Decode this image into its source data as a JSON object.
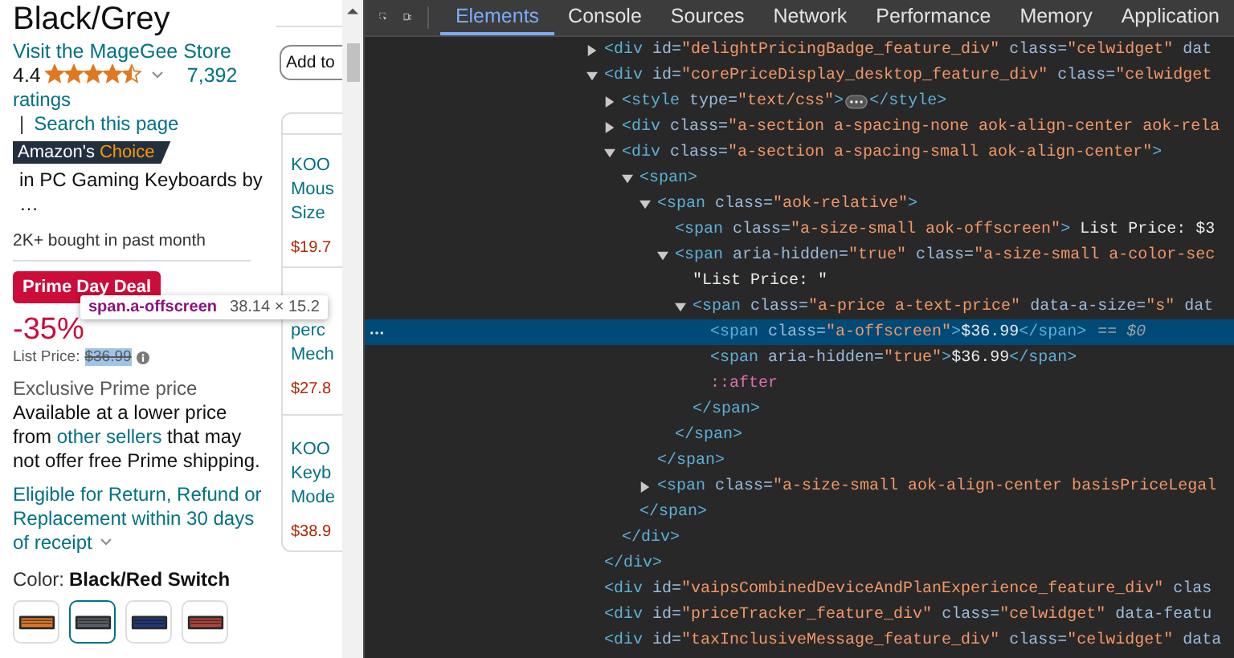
{
  "product": {
    "title": "Black/Grey",
    "store_link": "Visit the MageGee Store",
    "rating": {
      "value": "4.4",
      "stars": 4.5,
      "count_link": "7,392",
      "count_label": "ratings"
    },
    "separator": "|",
    "search_link": "Search this page",
    "choice_badge": {
      "prefix": "Amazon's",
      "highlight": "Choice"
    },
    "choice_category": "in PC Gaming Keyboards by …",
    "bought": "2K+ bought in past month",
    "deal_badge": "Prime Day Deal",
    "discount": "-35%",
    "list_price_label": "List Price:",
    "list_price": {
      "text": "$36.99",
      "inspected": true
    },
    "exclusive": "Exclusive Prime price",
    "availability": {
      "before": "Available at a lower price from",
      "link": "other sellers",
      "after": "that may not offer free Prime shipping."
    },
    "returns_link": "Eligible for Return, Refund or Replacement within 30 days of receipt",
    "color_label": "Color:",
    "color_value": "Black/Red Switch",
    "swatches": [
      {
        "selected": false,
        "color": "#e07a2a"
      },
      {
        "selected": true,
        "color": "#5a6068"
      },
      {
        "selected": false,
        "color": "#1f3a7a"
      },
      {
        "selected": false,
        "color": "#b0443c"
      }
    ]
  },
  "side_panel": {
    "add_button": "Add to",
    "cards": [
      {
        "lines": [
          "KOO",
          "Mous",
          "Size"
        ],
        "price": "$19.7"
      },
      {
        "lines": [
          "perc",
          "Mech"
        ],
        "price": "$27.8"
      },
      {
        "lines": [
          "KOO",
          "Keyb",
          "Mode"
        ],
        "price": "$38.9"
      }
    ]
  },
  "inspect_tooltip": {
    "selector": "span.a-offscreen",
    "size": "38.14 × 15.2"
  },
  "devtools": {
    "tabs": [
      {
        "label": "Elements",
        "selected": true
      },
      {
        "label": "Console",
        "selected": false
      },
      {
        "label": "Sources",
        "selected": false
      },
      {
        "label": "Network",
        "selected": false
      },
      {
        "label": "Performance",
        "selected": false
      },
      {
        "label": "Memory",
        "selected": false
      },
      {
        "label": "Application",
        "selected": false
      }
    ],
    "dom_tree": [
      {
        "selected": false,
        "expanded": false,
        "open": [
          {
            "kind": "tag",
            "text": "<div"
          },
          {
            "kind": "attr",
            "text": " id="
          },
          {
            "kind": "value",
            "text": "\"delightPricingBadge_feature_div\""
          },
          {
            "kind": "attr",
            "text": " class="
          },
          {
            "kind": "value",
            "text": "\"celwidget\""
          },
          {
            "kind": "attr",
            "text": " dat"
          }
        ]
      },
      {
        "selected": false,
        "expanded": true,
        "open": [
          {
            "kind": "tag",
            "text": "<div"
          },
          {
            "kind": "attr",
            "text": " id="
          },
          {
            "kind": "value",
            "text": "\"corePriceDisplay_desktop_feature_div\""
          },
          {
            "kind": "attr",
            "text": " class="
          },
          {
            "kind": "value",
            "text": "\"celwidget"
          }
        ],
        "close": [
          {
            "kind": "tag",
            "text": "</div>"
          }
        ],
        "children": [
          {
            "selected": false,
            "expanded": false,
            "open": [
              {
                "kind": "tag",
                "text": "<style"
              },
              {
                "kind": "attr",
                "text": " type="
              },
              {
                "kind": "value",
                "text": "\"text/css\""
              },
              {
                "kind": "tag",
                "text": ">"
              },
              {
                "kind": "ellipsis"
              },
              {
                "kind": "tag",
                "text": "</style>"
              }
            ]
          },
          {
            "selected": false,
            "expanded": false,
            "open": [
              {
                "kind": "tag",
                "text": "<div"
              },
              {
                "kind": "attr",
                "text": " class="
              },
              {
                "kind": "value",
                "text": "\"a-section a-spacing-none aok-align-center aok-rela"
              }
            ]
          },
          {
            "selected": false,
            "expanded": true,
            "open": [
              {
                "kind": "tag",
                "text": "<div"
              },
              {
                "kind": "attr",
                "text": " class="
              },
              {
                "kind": "value",
                "text": "\"a-section a-spacing-small aok-align-center\""
              },
              {
                "kind": "tag",
                "text": ">"
              }
            ],
            "close": [
              {
                "kind": "tag",
                "text": "</div>"
              }
            ],
            "children": [
              {
                "selected": false,
                "expanded": true,
                "open": [
                  {
                    "kind": "tag",
                    "text": "<span>"
                  }
                ],
                "close": [
                  {
                    "kind": "tag",
                    "text": "</span>"
                  }
                ],
                "children": [
                  {
                    "selected": false,
                    "expanded": true,
                    "open": [
                      {
                        "kind": "tag",
                        "text": "<span"
                      },
                      {
                        "kind": "attr",
                        "text": " class="
                      },
                      {
                        "kind": "value",
                        "text": "\"aok-relative\""
                      },
                      {
                        "kind": "tag",
                        "text": ">"
                      }
                    ],
                    "close": [
                      {
                        "kind": "tag",
                        "text": "</span>"
                      }
                    ],
                    "children": [
                      {
                        "selected": false,
                        "open": [
                          {
                            "kind": "tag",
                            "text": "<span"
                          },
                          {
                            "kind": "attr",
                            "text": " class="
                          },
                          {
                            "kind": "value",
                            "text": "\"a-size-small aok-offscreen\""
                          },
                          {
                            "kind": "tag",
                            "text": ">"
                          },
                          {
                            "kind": "text",
                            "text": " List Price: $3"
                          }
                        ]
                      },
                      {
                        "selected": false,
                        "expanded": true,
                        "open": [
                          {
                            "kind": "tag",
                            "text": "<span"
                          },
                          {
                            "kind": "attr",
                            "text": " aria-hidden="
                          },
                          {
                            "kind": "value",
                            "text": "\"true\""
                          },
                          {
                            "kind": "attr",
                            "text": " class="
                          },
                          {
                            "kind": "value",
                            "text": "\"a-size-small a-color-sec"
                          }
                        ],
                        "close": [
                          {
                            "kind": "tag",
                            "text": "</span>"
                          }
                        ],
                        "children": [
                          {
                            "selected": false,
                            "open": [
                              {
                                "kind": "text",
                                "text": "\"List Price: \""
                              }
                            ]
                          },
                          {
                            "selected": false,
                            "expanded": true,
                            "open": [
                              {
                                "kind": "tag",
                                "text": "<span"
                              },
                              {
                                "kind": "attr",
                                "text": " class="
                              },
                              {
                                "kind": "value",
                                "text": "\"a-price a-text-price\""
                              },
                              {
                                "kind": "attr",
                                "text": " data-a-size="
                              },
                              {
                                "kind": "value",
                                "text": "\"s\""
                              },
                              {
                                "kind": "attr",
                                "text": " dat"
                              }
                            ],
                            "close": [
                              {
                                "kind": "tag",
                                "text": "</span>"
                              }
                            ],
                            "children": [
                              {
                                "selected": true,
                                "open": [
                                  {
                                    "kind": "tag",
                                    "text": "<span"
                                  },
                                  {
                                    "kind": "attr",
                                    "text": " class="
                                  },
                                  {
                                    "kind": "value",
                                    "text": "\"a-offscreen\""
                                  },
                                  {
                                    "kind": "tag",
                                    "text": ">"
                                  },
                                  {
                                    "kind": "text",
                                    "text": "$36.99"
                                  },
                                  {
                                    "kind": "tag",
                                    "text": "</span>"
                                  },
                                  {
                                    "kind": "marker",
                                    "text": "== $0"
                                  }
                                ]
                              },
                              {
                                "selected": false,
                                "open": [
                                  {
                                    "kind": "tag",
                                    "text": "<span"
                                  },
                                  {
                                    "kind": "attr",
                                    "text": " aria-hidden="
                                  },
                                  {
                                    "kind": "value",
                                    "text": "\"true\""
                                  },
                                  {
                                    "kind": "tag",
                                    "text": ">"
                                  },
                                  {
                                    "kind": "text",
                                    "text": "$36.99"
                                  },
                                  {
                                    "kind": "tag",
                                    "text": "</span>"
                                  }
                                ]
                              },
                              {
                                "selected": false,
                                "open": [
                                  {
                                    "kind": "pseudo",
                                    "text": "::after"
                                  }
                                ]
                              }
                            ]
                          }
                        ]
                      }
                    ]
                  },
                  {
                    "selected": false,
                    "expanded": false,
                    "open": [
                      {
                        "kind": "tag",
                        "text": "<span"
                      },
                      {
                        "kind": "attr",
                        "text": " class="
                      },
                      {
                        "kind": "value",
                        "text": "\"a-size-small aok-align-center basisPriceLegal"
                      }
                    ]
                  }
                ]
              }
            ]
          }
        ]
      },
      {
        "selected": false,
        "open": [
          {
            "kind": "tag",
            "text": "<div"
          },
          {
            "kind": "attr",
            "text": " id="
          },
          {
            "kind": "value",
            "text": "\"vaipsCombinedDeviceAndPlanExperience_feature_div\""
          },
          {
            "kind": "attr",
            "text": " clas"
          }
        ]
      },
      {
        "selected": false,
        "open": [
          {
            "kind": "tag",
            "text": "<div"
          },
          {
            "kind": "attr",
            "text": " id="
          },
          {
            "kind": "value",
            "text": "\"priceTracker_feature_div\""
          },
          {
            "kind": "attr",
            "text": " class="
          },
          {
            "kind": "value",
            "text": "\"celwidget\""
          },
          {
            "kind": "attr",
            "text": " data-featu"
          }
        ]
      },
      {
        "selected": false,
        "open": [
          {
            "kind": "tag",
            "text": "<div"
          },
          {
            "kind": "attr",
            "text": " id="
          },
          {
            "kind": "value",
            "text": "\"taxInclusiveMessage_feature_div\""
          },
          {
            "kind": "attr",
            "text": " class="
          },
          {
            "kind": "value",
            "text": "\"celwidget\""
          },
          {
            "kind": "attr",
            "text": " data"
          }
        ]
      }
    ]
  }
}
